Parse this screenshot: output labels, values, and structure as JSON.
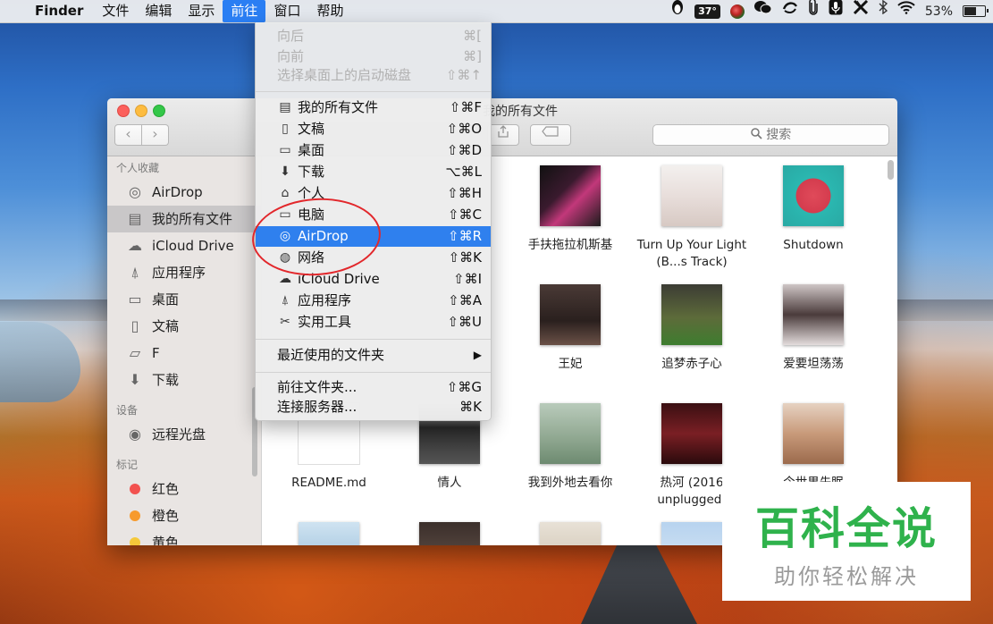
{
  "menubar": {
    "apple": "",
    "app": "Finder",
    "items": [
      "文件",
      "编辑",
      "显示",
      "前往",
      "窗口",
      "帮助"
    ],
    "active_index": 3,
    "status": {
      "temp": "37°",
      "battery": "53%"
    }
  },
  "go_menu": {
    "items": [
      {
        "label": "向后",
        "shortcut": "⌘[",
        "disabled": true
      },
      {
        "label": "向前",
        "shortcut": "⌘]",
        "disabled": true
      },
      {
        "label": "选择桌面上的启动磁盘",
        "shortcut": "⇧⌘↑",
        "disabled": true
      },
      {
        "label": "我的所有文件",
        "shortcut": "⇧⌘F",
        "icon": "all-files-icon"
      },
      {
        "label": "文稿",
        "shortcut": "⇧⌘O",
        "icon": "documents-icon"
      },
      {
        "label": "桌面",
        "shortcut": "⇧⌘D",
        "icon": "desktop-icon"
      },
      {
        "label": "下载",
        "shortcut": "⌥⌘L",
        "icon": "downloads-icon"
      },
      {
        "label": "个人",
        "shortcut": "⇧⌘H",
        "icon": "home-icon"
      },
      {
        "label": "电脑",
        "shortcut": "⇧⌘C",
        "icon": "computer-icon"
      },
      {
        "label": "AirDrop",
        "shortcut": "⇧⌘R",
        "icon": "airdrop-icon",
        "highlighted": true
      },
      {
        "label": "网络",
        "shortcut": "⇧⌘K",
        "icon": "network-icon"
      },
      {
        "label": "iCloud Drive",
        "shortcut": "⇧⌘I",
        "icon": "cloud-icon"
      },
      {
        "label": "应用程序",
        "shortcut": "⇧⌘A",
        "icon": "applications-icon"
      },
      {
        "label": "实用工具",
        "shortcut": "⇧⌘U",
        "icon": "utilities-icon"
      },
      {
        "label": "最近使用的文件夹",
        "shortcut": "▶"
      },
      {
        "label": "前往文件夹...",
        "shortcut": "⇧⌘G"
      },
      {
        "label": "连接服务器...",
        "shortcut": "⌘K"
      }
    ]
  },
  "finder": {
    "title": "我的所有文件",
    "search_placeholder": "搜索",
    "sidebar": {
      "favorites_header": "个人收藏",
      "favorites": [
        "AirDrop",
        "我的所有文件",
        "iCloud Drive",
        "应用程序",
        "桌面",
        "文稿",
        "F",
        "下载"
      ],
      "devices_header": "设备",
      "devices": [
        "远程光盘"
      ],
      "tags_header": "标记",
      "tags": [
        {
          "label": "红色",
          "color": "#f2524f"
        },
        {
          "label": "橙色",
          "color": "#f79a2c"
        },
        {
          "label": "黄色",
          "color": "#f5c93a"
        }
      ]
    },
    "files": [
      {
        "name": "手扶拖拉机斯基"
      },
      {
        "name": "Turn Up Your Light (B...s Track)"
      },
      {
        "name": "Shutdown"
      },
      {
        "name": "王妃"
      },
      {
        "name": "追梦赤子心"
      },
      {
        "name": "爱要坦荡荡"
      },
      {
        "name": "README.md"
      },
      {
        "name": "情人"
      },
      {
        "name": "我到外地去看你"
      },
      {
        "name": "热河 (2016 unplugged)"
      },
      {
        "name": "今世果先眠"
      }
    ]
  },
  "watermark": {
    "title": "百科全说",
    "subtitle": "助你轻松解决"
  }
}
